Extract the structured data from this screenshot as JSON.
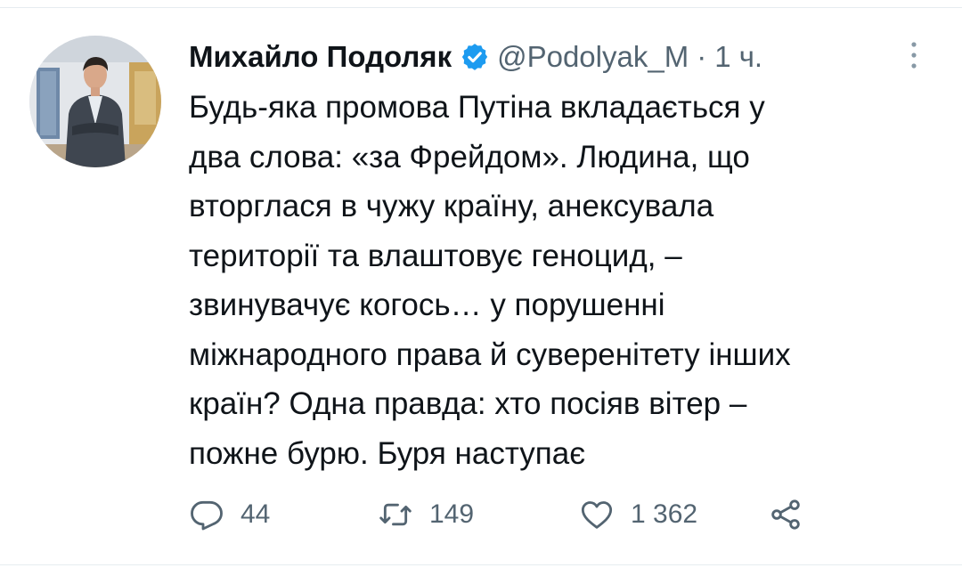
{
  "tweet": {
    "author_name": "Михайло Подоляк",
    "handle": "@Podolyak_M",
    "separator": "·",
    "timestamp": "1 ч.",
    "verified": true,
    "text_lines": [
      "Будь-яка промова Путіна вкладається у",
      "два слова: «за Фрейдом». Людина, що",
      "вторглася в чужу країну, анексувала",
      "території та влаштовує геноцид, –",
      "звинувачує когось… у порушенні",
      "міжнародного права й суверенітету інших",
      "країн? Одна правда: хто посіяв вітер –",
      "пожне бурю. Буря наступає"
    ]
  },
  "actions": {
    "reply_count": "44",
    "retweet_count": "149",
    "like_count": "1 362"
  },
  "icons": {
    "verified": "verified-badge-icon",
    "more": "more-vertical-icon",
    "reply": "reply-icon",
    "retweet": "retweet-icon",
    "like": "heart-icon",
    "share": "share-icon"
  },
  "colors": {
    "text_primary": "#0f1419",
    "text_secondary": "#536471",
    "verified_blue": "#1d9bf0",
    "divider": "#e6ecf0"
  }
}
